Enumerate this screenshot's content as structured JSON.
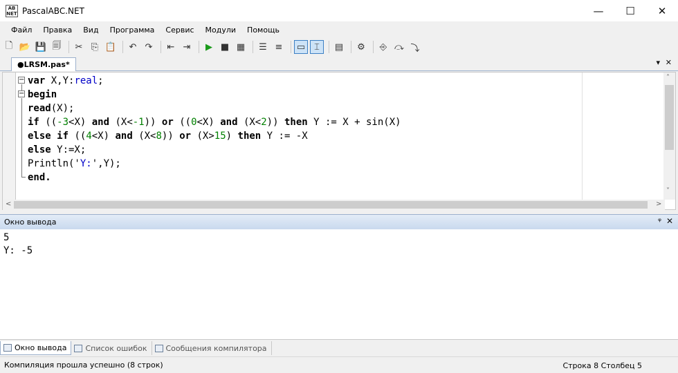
{
  "window": {
    "title": "PascalABC.NET",
    "icon_text": "AB NET",
    "controls": {
      "minimize": "—",
      "maximize": "☐",
      "close": "✕"
    }
  },
  "menu": [
    "Файл",
    "Правка",
    "Вид",
    "Программа",
    "Сервис",
    "Модули",
    "Помощь"
  ],
  "toolbar": {
    "buttons": [
      {
        "name": "new-file-icon",
        "glyph": "🗋"
      },
      {
        "name": "open-folder-icon",
        "glyph": "📂"
      },
      {
        "name": "save-icon",
        "glyph": "💾"
      },
      {
        "name": "save-all-icon",
        "glyph": "🗐"
      },
      {
        "name": "cut-icon",
        "glyph": "✂"
      },
      {
        "name": "copy-icon",
        "glyph": "⎘"
      },
      {
        "name": "paste-icon",
        "glyph": "📋"
      },
      {
        "name": "undo-icon",
        "glyph": "↶"
      },
      {
        "name": "redo-icon",
        "glyph": "↷"
      },
      {
        "name": "navigate-back-icon",
        "glyph": "⇤"
      },
      {
        "name": "navigate-forward-icon",
        "glyph": "⇥"
      },
      {
        "name": "run-icon",
        "glyph": "▶"
      },
      {
        "name": "stop-icon",
        "glyph": "■"
      },
      {
        "name": "compile-icon",
        "glyph": "▦"
      },
      {
        "name": "comment-icon",
        "glyph": "☰"
      },
      {
        "name": "uncomment-icon",
        "glyph": "≡"
      },
      {
        "name": "output-window-icon",
        "glyph": "▭"
      },
      {
        "name": "input-window-icon",
        "glyph": "⌶"
      },
      {
        "name": "form-designer-icon",
        "glyph": "▤"
      },
      {
        "name": "settings-icon",
        "glyph": "⚙"
      },
      {
        "name": "debug-start-icon",
        "glyph": "⎆"
      },
      {
        "name": "step-over-icon",
        "glyph": "⤼"
      },
      {
        "name": "step-into-icon",
        "glyph": "⤵"
      }
    ]
  },
  "document_tab": {
    "label": "●LRSM.pas*",
    "dropdown": "▾",
    "close": "✕"
  },
  "editor": {
    "lines": [
      [
        {
          "t": "var ",
          "c": "kw"
        },
        {
          "t": "X,Y:"
        },
        {
          "t": "real",
          "c": "typ"
        },
        {
          "t": ";"
        }
      ],
      [
        {
          "t": "begin",
          "c": "kw"
        }
      ],
      [
        {
          "t": "read",
          "c": "kw"
        },
        {
          "t": "(X);"
        }
      ],
      [
        {
          "t": "if",
          "c": "kw"
        },
        {
          "t": " (("
        },
        {
          "t": "-3",
          "c": "num"
        },
        {
          "t": "<X) "
        },
        {
          "t": "and",
          "c": "kw"
        },
        {
          "t": " (X<"
        },
        {
          "t": "-1",
          "c": "num"
        },
        {
          "t": ")) "
        },
        {
          "t": "or",
          "c": "kw"
        },
        {
          "t": " (("
        },
        {
          "t": "0",
          "c": "num"
        },
        {
          "t": "<X) "
        },
        {
          "t": "and",
          "c": "kw"
        },
        {
          "t": " (X<"
        },
        {
          "t": "2",
          "c": "num"
        },
        {
          "t": ")) "
        },
        {
          "t": "then",
          "c": "kw"
        },
        {
          "t": " Y := X + sin(X)"
        }
      ],
      [
        {
          "t": "else if",
          "c": "kw"
        },
        {
          "t": " (("
        },
        {
          "t": "4",
          "c": "num"
        },
        {
          "t": "<X) "
        },
        {
          "t": "and",
          "c": "kw"
        },
        {
          "t": " (X<"
        },
        {
          "t": "8",
          "c": "num"
        },
        {
          "t": ")) "
        },
        {
          "t": "or",
          "c": "kw"
        },
        {
          "t": " (X>"
        },
        {
          "t": "15",
          "c": "num"
        },
        {
          "t": ") "
        },
        {
          "t": "then",
          "c": "kw"
        },
        {
          "t": " Y := -X"
        }
      ],
      [
        {
          "t": "else",
          "c": "kw"
        },
        {
          "t": " Y:=X;"
        }
      ],
      [
        {
          "t": "Println('"
        },
        {
          "t": "Y:",
          "c": "str"
        },
        {
          "t": "',Y);"
        }
      ],
      [
        {
          "t": "end.",
          "c": "kw"
        }
      ]
    ],
    "fold_markers": [
      "−",
      "−"
    ]
  },
  "output_panel": {
    "title": "Окно вывода",
    "pin": "ᵠ",
    "close": "✕",
    "lines": [
      "5",
      "Y: -5"
    ]
  },
  "bottom_tabs": [
    "Окно вывода",
    "Список ошибок",
    "Сообщения компилятора"
  ],
  "status": {
    "message": "Компиляция прошла успешно (8 строк)",
    "position": "Строка  8  Столбец  5"
  },
  "scroll": {
    "up": "˄",
    "down": "˅",
    "left": "<",
    "right": ">"
  }
}
